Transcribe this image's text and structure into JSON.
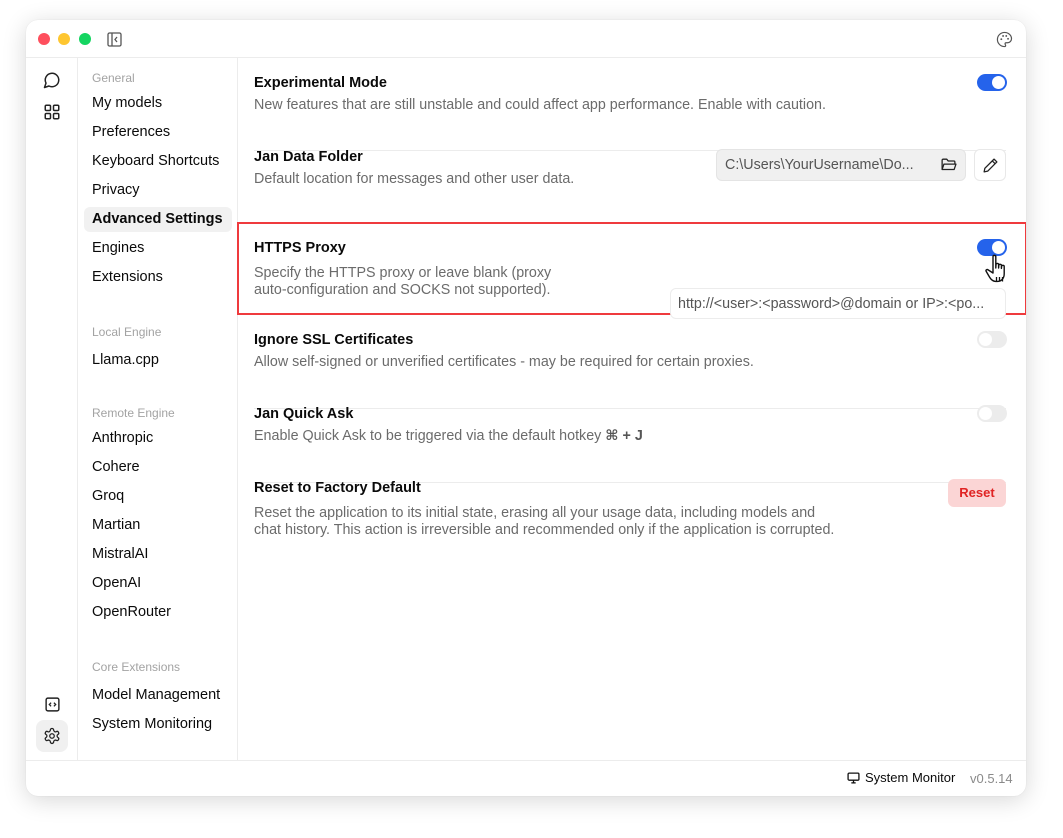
{
  "app": {
    "window_controls": [
      "close",
      "minimize",
      "maximize"
    ],
    "icons": {
      "sidebar_toggle": "sidebar-collapse-icon",
      "theme": "palette-icon"
    }
  },
  "iconbar": {
    "top": [
      {
        "name": "chat-icon",
        "label": "Threads"
      },
      {
        "name": "grid-icon",
        "label": "Hub"
      }
    ],
    "bottom": [
      {
        "name": "code-icon",
        "label": "Local API Server"
      },
      {
        "name": "gear-icon",
        "label": "Settings",
        "active": true
      }
    ]
  },
  "nav": {
    "groups": [
      {
        "title": "General",
        "items": [
          "My models",
          "Preferences",
          "Keyboard Shortcuts",
          "Privacy",
          "Advanced Settings",
          "Engines",
          "Extensions"
        ]
      },
      {
        "title": "Local Engine",
        "items": [
          "Llama.cpp"
        ]
      },
      {
        "title": "Remote Engine",
        "items": [
          "Anthropic",
          "Cohere",
          "Groq",
          "Martian",
          "MistralAI",
          "OpenAI",
          "OpenRouter"
        ]
      },
      {
        "title": "Core Extensions",
        "items": [
          "Model Management",
          "System Monitoring"
        ]
      }
    ],
    "active_item": "Advanced Settings"
  },
  "settings": {
    "experimental": {
      "title": "Experimental Mode",
      "description": "New features that are still unstable and could affect app performance. Enable with caution.",
      "enabled": true
    },
    "data_folder": {
      "title": "Jan Data Folder",
      "description": "Default location for messages and other user data.",
      "value": "C:\\Users\\YourUsername\\Do..."
    },
    "https_proxy": {
      "title": "HTTPS Proxy",
      "description_line1": "Specify the HTTPS proxy or leave blank (proxy",
      "description_line2": "auto-configuration and SOCKS not supported).",
      "enabled": true,
      "placeholder": "http://<user>:<password>@domain or IP>:<po...",
      "value": ""
    },
    "ignore_ssl": {
      "title": "Ignore SSL Certificates",
      "description": "Allow self-signed or unverified certificates - may be required for certain proxies.",
      "enabled": false
    },
    "quick_ask": {
      "title": "Jan Quick Ask",
      "description": "Enable Quick Ask to be triggered via the default hotkey ",
      "hotkey": "⌘ + J",
      "enabled": false
    },
    "factory_reset": {
      "title": "Reset to Factory Default",
      "description_line1": "Reset the application to its initial state, erasing all your usage data, including models and",
      "description_line2": "chat history. This action is irreversible and recommended only if the application is corrupted.",
      "button_label": "Reset"
    }
  },
  "statusbar": {
    "system_monitor_label": "System Monitor",
    "version": "v0.5.14"
  },
  "colors": {
    "accent": "#2563eb",
    "highlight_border": "#ef3a3d",
    "danger_bg": "#fbd5d5",
    "danger_text": "#e02424"
  }
}
